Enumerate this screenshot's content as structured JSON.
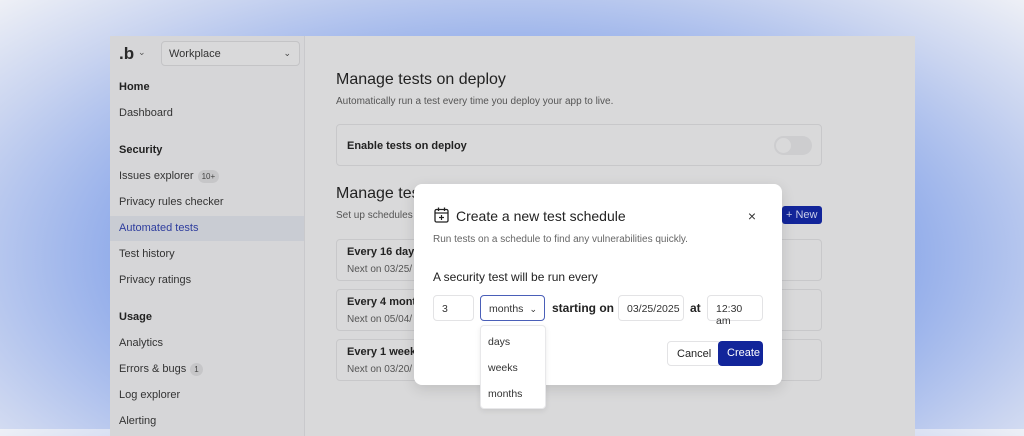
{
  "sidebar": {
    "logo": ".b",
    "workspace": "Workplace",
    "sections": [
      {
        "title": "Home"
      },
      {
        "title": "Security"
      },
      {
        "title": "Usage"
      }
    ],
    "items": [
      {
        "label": "Dashboard"
      },
      {
        "label": "Issues explorer",
        "badge": "10+"
      },
      {
        "label": "Privacy rules checker"
      },
      {
        "label": "Automated tests",
        "active": true
      },
      {
        "label": "Test history"
      },
      {
        "label": "Privacy ratings"
      },
      {
        "label": "Analytics"
      },
      {
        "label": "Errors & bugs",
        "badge": "1"
      },
      {
        "label": "Log explorer"
      },
      {
        "label": "Alerting"
      }
    ]
  },
  "main": {
    "deploy": {
      "title": "Manage tests on deploy",
      "subtitle": "Automatically run a test every time you deploy your app to live.",
      "toggle_label": "Enable tests on deploy",
      "toggle_on": false
    },
    "schedules": {
      "title": "Manage tes",
      "subtitle": "Set up schedules",
      "new_label": "+ New",
      "cards": [
        {
          "title": "Every 16 days",
          "next": "Next on 03/25/"
        },
        {
          "title": "Every 4 month",
          "next": "Next on 05/04/"
        },
        {
          "title": "Every 1 week",
          "next": "Next on 03/20/"
        }
      ]
    }
  },
  "modal": {
    "title": "Create a new test schedule",
    "subtitle": "Run tests on a schedule to find any vulnerabilities quickly.",
    "lead": "A security test will be run every",
    "interval": "3",
    "unit": "months",
    "starting_label": "starting on",
    "date": "03/25/2025",
    "at_label": "at",
    "time": "12:30 am",
    "cancel": "Cancel",
    "create": "Create",
    "close": "×",
    "unit_options": [
      "days",
      "weeks",
      "months"
    ]
  },
  "colors": {
    "primary": "#12259a",
    "active_text": "#2e3d9e"
  }
}
